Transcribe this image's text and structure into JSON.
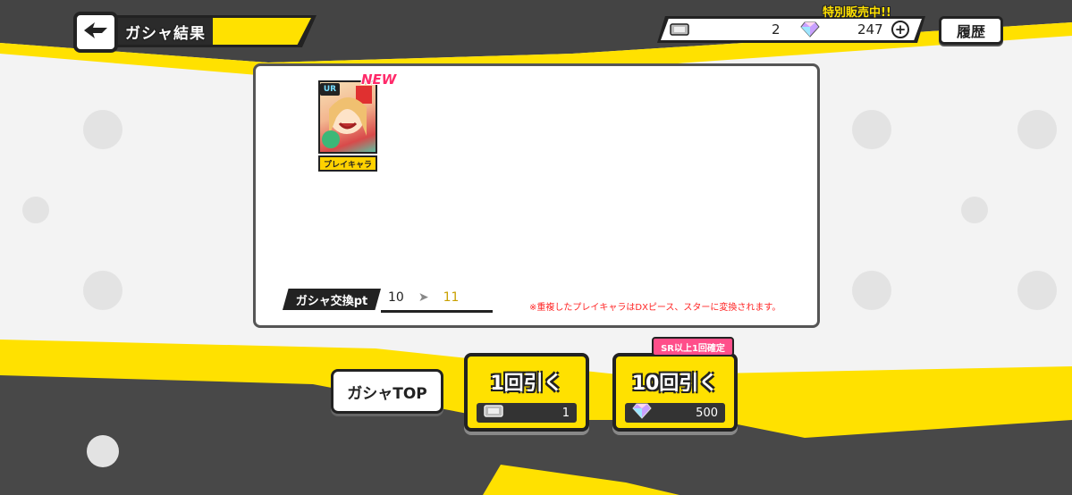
{
  "header": {
    "back_icon": "back-arrow-icon",
    "title": "ガシャ結果",
    "ticket_icon": "ticket-icon",
    "ticket_count": "2",
    "sale_label": "特別販売中!!",
    "gem_icon": "rainbow-gem-icon",
    "gem_count": "247",
    "plus_label": "+",
    "history_label": "履歴"
  },
  "result": {
    "card": {
      "new_label": "NEW",
      "rarity": "UR",
      "tag": "プレイキャラ"
    },
    "points": {
      "label": "ガシャ交換pt",
      "from": "10",
      "to": "11"
    },
    "note": "※重複したプレイキャラはDXピース、スターに変換されます。"
  },
  "actions": {
    "top_label": "ガシャTOP",
    "single": {
      "title": "1回引く",
      "cost": "1",
      "currency_icon": "ticket-icon"
    },
    "multi": {
      "title": "10回引く",
      "cost": "500",
      "currency_icon": "rainbow-gem-icon",
      "promo": "SR以上1回確定"
    }
  },
  "colors": {
    "accent_yellow": "#ffe100",
    "dark": "#222222",
    "promo_pink": "#ff4f8a",
    "note_red": "#ff2424"
  }
}
